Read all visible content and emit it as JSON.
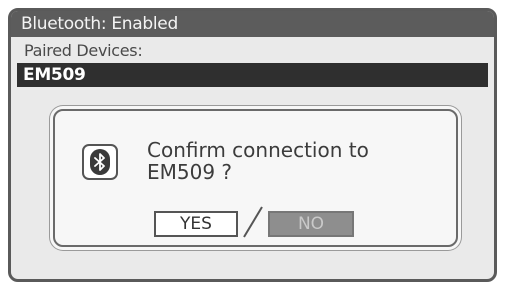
{
  "header": {
    "title": "Bluetooth: Enabled"
  },
  "paired": {
    "label": "Paired Devices:",
    "selected_device": "EM509"
  },
  "dialog": {
    "icon": "bluetooth-icon",
    "message_line1": "Confirm connection to",
    "message_line2": "EM509 ?",
    "yes_label": "YES",
    "no_label": "NO"
  }
}
